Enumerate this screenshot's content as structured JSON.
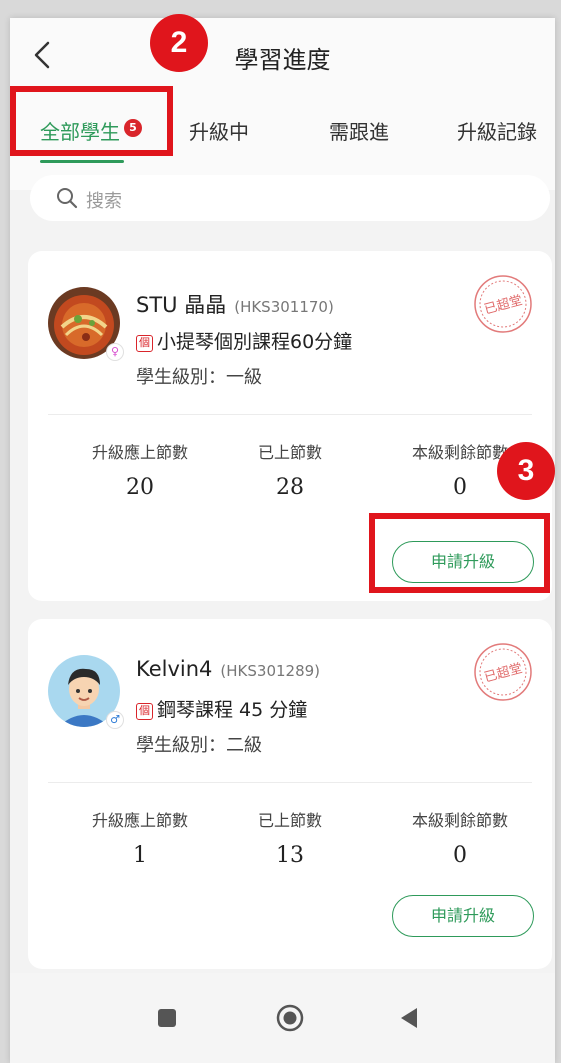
{
  "header": {
    "title": "學習進度"
  },
  "tabs": [
    {
      "label": "全部學生",
      "badge": "5",
      "active": true
    },
    {
      "label": "升級中"
    },
    {
      "label": "需跟進"
    },
    {
      "label": "升級記錄"
    }
  ],
  "search": {
    "placeholder": "搜索"
  },
  "stat_labels": {
    "required": "升級應上節數",
    "attended": "已上節數",
    "remaining": "本級剩餘節數"
  },
  "students": [
    {
      "name": "STU 晶晶",
      "code": "(HKS301170)",
      "course_tag": "個",
      "course": "小提琴個別課程60分鐘",
      "level": "學生級別：一級",
      "stamp": "已超堂",
      "gender": "female",
      "required": "20",
      "attended": "28",
      "remaining": "0",
      "apply_label": "申請升級"
    },
    {
      "name": "Kelvin4",
      "code": "(HKS301289)",
      "course_tag": "個",
      "course": "鋼琴課程 45 分鐘",
      "level": "學生級別：二級",
      "stamp": "已超堂",
      "gender": "male",
      "required": "1",
      "attended": "13",
      "remaining": "0",
      "apply_label": "申請升級"
    }
  ],
  "annotations": {
    "step2": "2",
    "step3": "3"
  },
  "colors": {
    "accent": "#2e9a5a",
    "badge": "#d9252b",
    "annotation": "#e0151c"
  }
}
